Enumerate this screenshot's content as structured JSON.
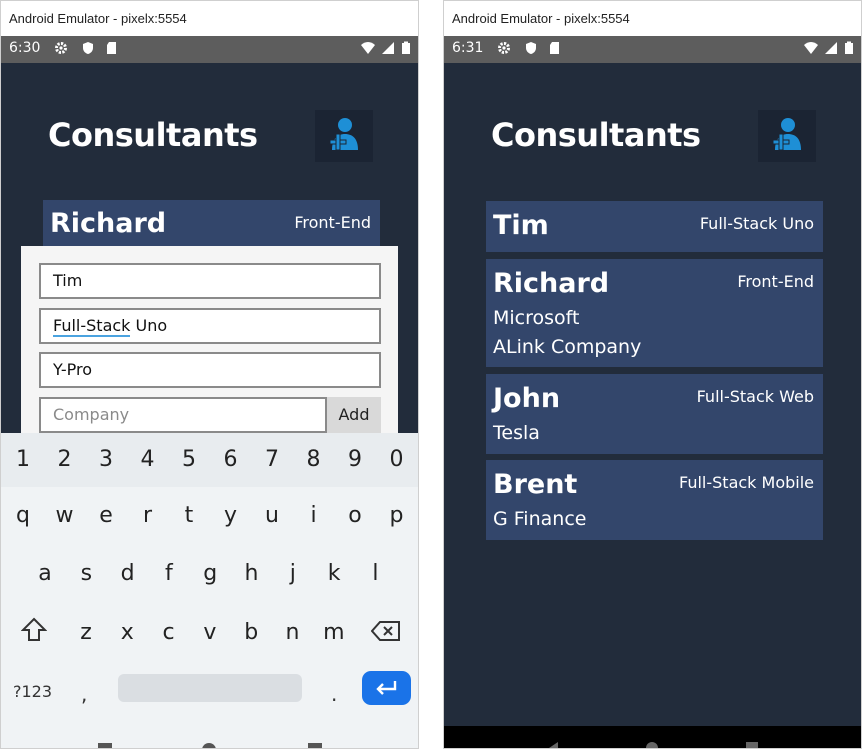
{
  "left": {
    "window_title": "Android Emulator - pixelx:5554",
    "status_time": "6:30",
    "app_title": "Consultants",
    "card": {
      "name": "Richard",
      "role": "Front-End"
    },
    "form": {
      "name_value": "Tim",
      "role_word1": "Full-Stack",
      "role_word2": " Uno",
      "skill_value": "Y-Pro",
      "company_placeholder": "Company",
      "add_label": "Add"
    },
    "keyboard": {
      "numbers": [
        "1",
        "2",
        "3",
        "4",
        "5",
        "6",
        "7",
        "8",
        "9",
        "0"
      ],
      "row1": [
        "q",
        "w",
        "e",
        "r",
        "t",
        "y",
        "u",
        "i",
        "o",
        "p"
      ],
      "row2": [
        "a",
        "s",
        "d",
        "f",
        "g",
        "h",
        "j",
        "k",
        "l"
      ],
      "row3": [
        "z",
        "x",
        "c",
        "v",
        "b",
        "n",
        "m"
      ],
      "sym_label": "?123",
      "comma": ",",
      "dot": "."
    }
  },
  "right": {
    "window_title": "Android Emulator - pixelx:5554",
    "status_time": "6:31",
    "app_title": "Consultants",
    "consultants": [
      {
        "name": "Tim",
        "role": "Full-Stack Uno",
        "companies": []
      },
      {
        "name": "Richard",
        "role": "Front-End",
        "companies": [
          "Microsoft",
          "ALink Company"
        ]
      },
      {
        "name": "John",
        "role": "Full-Stack Web",
        "companies": [
          "Tesla"
        ]
      },
      {
        "name": "Brent",
        "role": "Full-Stack Mobile",
        "companies": [
          "G Finance"
        ]
      }
    ]
  },
  "colors": {
    "app_bg": "#222c3b",
    "card_bg": "#33466b",
    "accent_blue": "#1a73e8",
    "icon_blue": "#1e8fd6"
  }
}
